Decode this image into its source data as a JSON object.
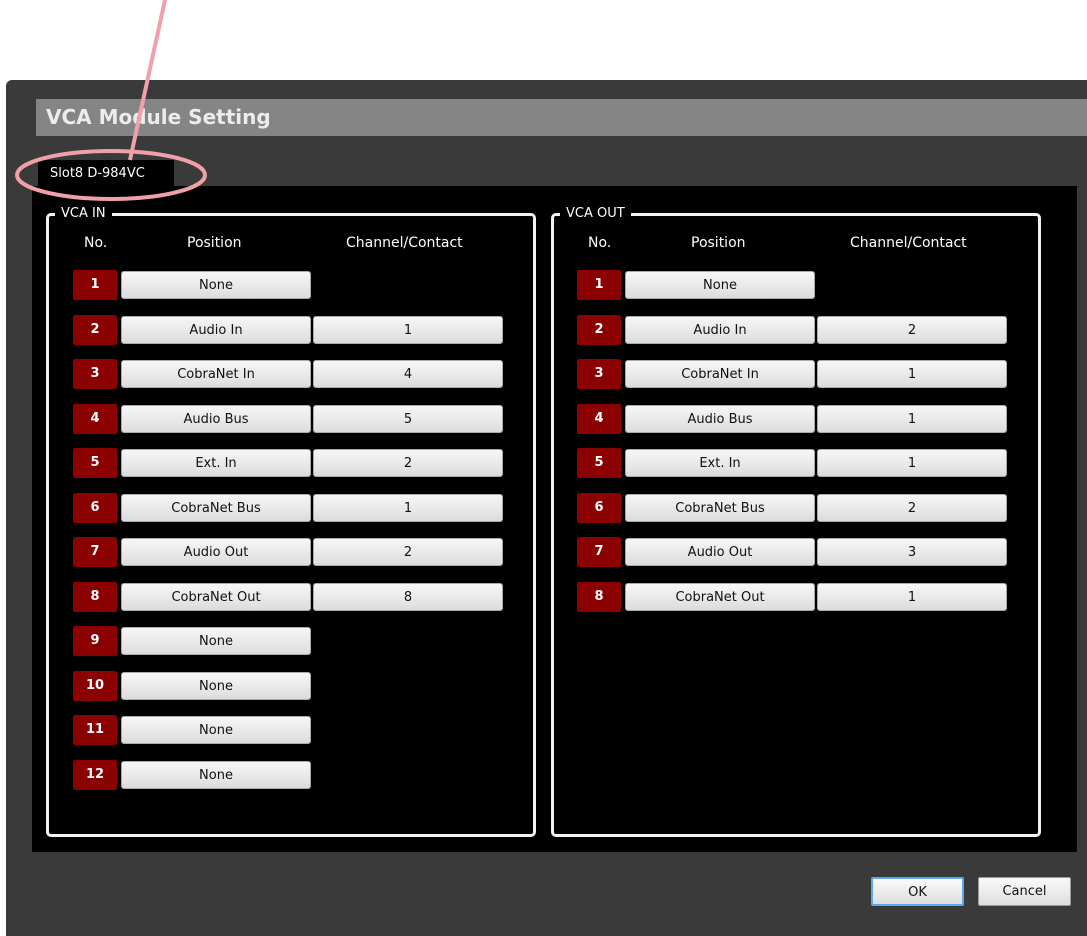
{
  "dialog": {
    "title": "VCA Module Setting"
  },
  "tab": {
    "label": "Slot8  D-984VC"
  },
  "headers": {
    "no": "No.",
    "position": "Position",
    "channel": "Channel/Contact"
  },
  "vca_in": {
    "label": "VCA IN",
    "rows": [
      {
        "no": "1",
        "position": "None",
        "channel": null
      },
      {
        "no": "2",
        "position": "Audio In",
        "channel": "1"
      },
      {
        "no": "3",
        "position": "CobraNet In",
        "channel": "4"
      },
      {
        "no": "4",
        "position": "Audio Bus",
        "channel": "5"
      },
      {
        "no": "5",
        "position": "Ext. In",
        "channel": "2"
      },
      {
        "no": "6",
        "position": "CobraNet Bus",
        "channel": "1"
      },
      {
        "no": "7",
        "position": "Audio Out",
        "channel": "2"
      },
      {
        "no": "8",
        "position": "CobraNet Out",
        "channel": "8"
      },
      {
        "no": "9",
        "position": "None",
        "channel": null
      },
      {
        "no": "10",
        "position": "None",
        "channel": null
      },
      {
        "no": "11",
        "position": "None",
        "channel": null
      },
      {
        "no": "12",
        "position": "None",
        "channel": null
      }
    ]
  },
  "vca_out": {
    "label": "VCA OUT",
    "rows": [
      {
        "no": "1",
        "position": "None",
        "channel": null
      },
      {
        "no": "2",
        "position": "Audio In",
        "channel": "2"
      },
      {
        "no": "3",
        "position": "CobraNet In",
        "channel": "1"
      },
      {
        "no": "4",
        "position": "Audio Bus",
        "channel": "1"
      },
      {
        "no": "5",
        "position": "Ext. In",
        "channel": "1"
      },
      {
        "no": "6",
        "position": "CobraNet Bus",
        "channel": "2"
      },
      {
        "no": "7",
        "position": "Audio Out",
        "channel": "3"
      },
      {
        "no": "8",
        "position": "CobraNet Out",
        "channel": "1"
      }
    ]
  },
  "footer": {
    "ok_label": "OK",
    "cancel_label": "Cancel"
  },
  "colors": {
    "number_badge": "#8b0000",
    "annotation": "#f2a0a8",
    "ok_focus": "#5fa8e8"
  }
}
